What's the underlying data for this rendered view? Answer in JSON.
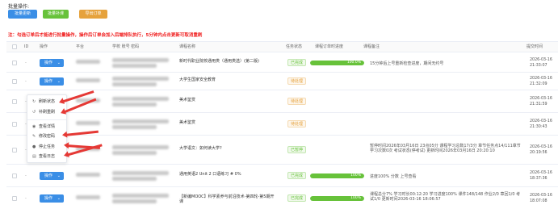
{
  "batch": {
    "title": "批量操作:",
    "buttons": [
      "批量更新",
      "批量补课",
      "导出订单"
    ],
    "notice": "注：勾选订单后才能进行批量操作，操作后订单会加入后端排队执行，5分钟内点击更新可取消重刷"
  },
  "table": {
    "headers": [
      "ID",
      "操作",
      "平台",
      "学校 账号 密码",
      "课程名称",
      "任务状态",
      "课程订单时进度",
      "课程备注",
      "提交时间"
    ],
    "op_label": "操作",
    "rows": [
      {
        "course": "新时代职业院校通用类（通用类选）(第二版)",
        "status": "已完成",
        "status_kind": "done",
        "progress_pct": 100,
        "progress_text": "100.0%",
        "remark": "15分钟后上号重新检查进度，期间无约号",
        "date": "2026-03-16",
        "time": "21:33:07"
      },
      {
        "course": "大学生国家安全教育",
        "status": "待处理",
        "status_kind": "wait",
        "progress_pct": 0,
        "progress_text": "",
        "remark": "",
        "date": "2026-03-16",
        "time": "21:32:09"
      },
      {
        "course": "美术鉴赏",
        "status": "待处理",
        "status_kind": "wait",
        "progress_pct": 0,
        "progress_text": "",
        "remark": "",
        "date": "2026-03-16",
        "time": "21:31:59"
      },
      {
        "course": "美术鉴赏",
        "status": "待处理",
        "status_kind": "wait",
        "progress_pct": 0,
        "progress_text": "",
        "remark": "",
        "date": "2026-03-16",
        "time": "21:30:43"
      },
      {
        "course": "大学语文：如何读大学?",
        "status": "已暂停",
        "status_kind": "pause",
        "progress_pct": 0,
        "progress_text": "",
        "remark_lines": [
          "暂停时间2026年03月16日 23点05分 课程学习总数17/3分 章节任务点14/111章节学习次数0次 考试状态(停考试) 更新时间2026年03月16日 20:20:10"
        ],
        "date": "2026-03-16",
        "time": "20:19:56"
      },
      {
        "course": "通用英语2 Unit 2 口语练习 # 0%",
        "status": "已完成",
        "status_kind": "done",
        "progress_pct": 100,
        "progress_text": "100%",
        "remark": "进度100% 分数 上号查看",
        "date": "2026-03-16",
        "time": "18:37:36"
      },
      {
        "course": "【新编MOOC】科学素养与前沿技术-第四轮-第5期开课",
        "status": "已完成",
        "status_kind": "done",
        "progress_pct": 100,
        "progress_text": "100%",
        "remark_lines": [
          "课程总分7% 学习时长00:12:20 学习进度100% 课件148/148 作业2/0 章回1/0 考试1/0 更新时间2026-03-16 18:06:57"
        ],
        "date": "2026-03-16",
        "time": "18:07:08"
      }
    ]
  },
  "dropdown": {
    "items": [
      {
        "icon": "refresh-icon",
        "glyph": "↻",
        "label": "刷新状态"
      },
      {
        "icon": "redo-icon",
        "glyph": "↺",
        "label": "补刷重刷"
      },
      {
        "icon": "eye-icon",
        "glyph": "◉",
        "label": "查看详情"
      },
      {
        "icon": "edit-icon",
        "glyph": "✎",
        "label": "修改密码"
      },
      {
        "icon": "stop-icon",
        "glyph": "●",
        "label": "停止任务"
      },
      {
        "icon": "log-icon",
        "glyph": "▤",
        "label": "查看日志"
      }
    ]
  },
  "colors": {
    "primary": "#3a8ee6",
    "success": "#67c23a",
    "warning": "#e6a23c",
    "danger": "#f01e1e",
    "arrow": "#e53935"
  }
}
